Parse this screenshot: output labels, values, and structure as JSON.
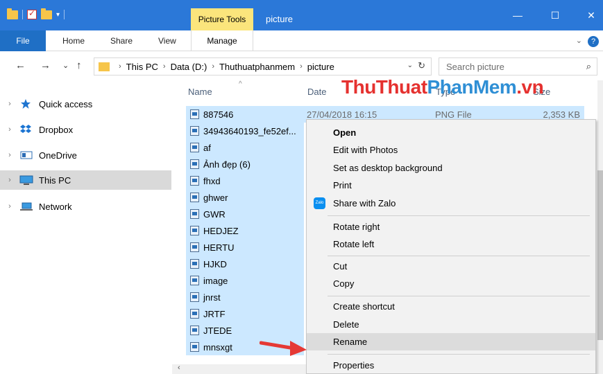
{
  "titlebar": {
    "picture_tools": "Picture Tools",
    "title": "picture",
    "minimize": "—",
    "maximize": "☐",
    "close": "✕"
  },
  "ribbon": {
    "file": "File",
    "home": "Home",
    "share": "Share",
    "view": "View",
    "manage": "Manage",
    "help": "?"
  },
  "address": {
    "back": "←",
    "forward": "→",
    "recent": "⌄",
    "up": "↑",
    "crumbs": [
      "This PC",
      "Data (D:)",
      "Thuthuatphanmem",
      "picture"
    ],
    "search_placeholder": "Search picture"
  },
  "nav": {
    "items": [
      {
        "label": "Quick access",
        "icon": "star-icon"
      },
      {
        "label": "Dropbox",
        "icon": "dropbox-icon"
      },
      {
        "label": "OneDrive",
        "icon": "onedrive-icon"
      },
      {
        "label": "This PC",
        "icon": "pc-icon",
        "selected": true
      },
      {
        "label": "Network",
        "icon": "network-icon"
      }
    ]
  },
  "columns": {
    "name": "Name",
    "date": "Date",
    "type": "Type",
    "size": "Size"
  },
  "watermark": {
    "part1": "ThuThuat",
    "part2": "PhanMem",
    "part3": ".vn"
  },
  "files": [
    {
      "name": "887546",
      "date": "27/04/2018 16:15",
      "type": "PNG File",
      "size": "2,353 KB"
    },
    {
      "name": "34943640193_fe52ef..."
    },
    {
      "name": "af"
    },
    {
      "name": "Ảnh đẹp (6)"
    },
    {
      "name": "fhxd"
    },
    {
      "name": "ghwer"
    },
    {
      "name": "GWR"
    },
    {
      "name": "HEDJEZ"
    },
    {
      "name": "HERTU"
    },
    {
      "name": "HJKD"
    },
    {
      "name": "image"
    },
    {
      "name": "jnrst"
    },
    {
      "name": "JRTF"
    },
    {
      "name": "JTEDE"
    },
    {
      "name": "mnsxgt"
    }
  ],
  "context_menu": {
    "open": "Open",
    "edit_photos": "Edit with Photos",
    "set_background": "Set as desktop background",
    "print": "Print",
    "share_zalo": "Share with Zalo",
    "zalo_icon_text": "Zalo",
    "rotate_right": "Rotate right",
    "rotate_left": "Rotate left",
    "cut": "Cut",
    "copy": "Copy",
    "create_shortcut": "Create shortcut",
    "delete": "Delete",
    "rename": "Rename",
    "properties": "Properties"
  },
  "colors": {
    "titlebar": "#2b78d8",
    "picture_tools": "#fbe57c",
    "selection": "#cce8ff",
    "watermark_red": "#e5312f",
    "watermark_blue": "#2f8fd5",
    "arrow": "#e53935"
  }
}
